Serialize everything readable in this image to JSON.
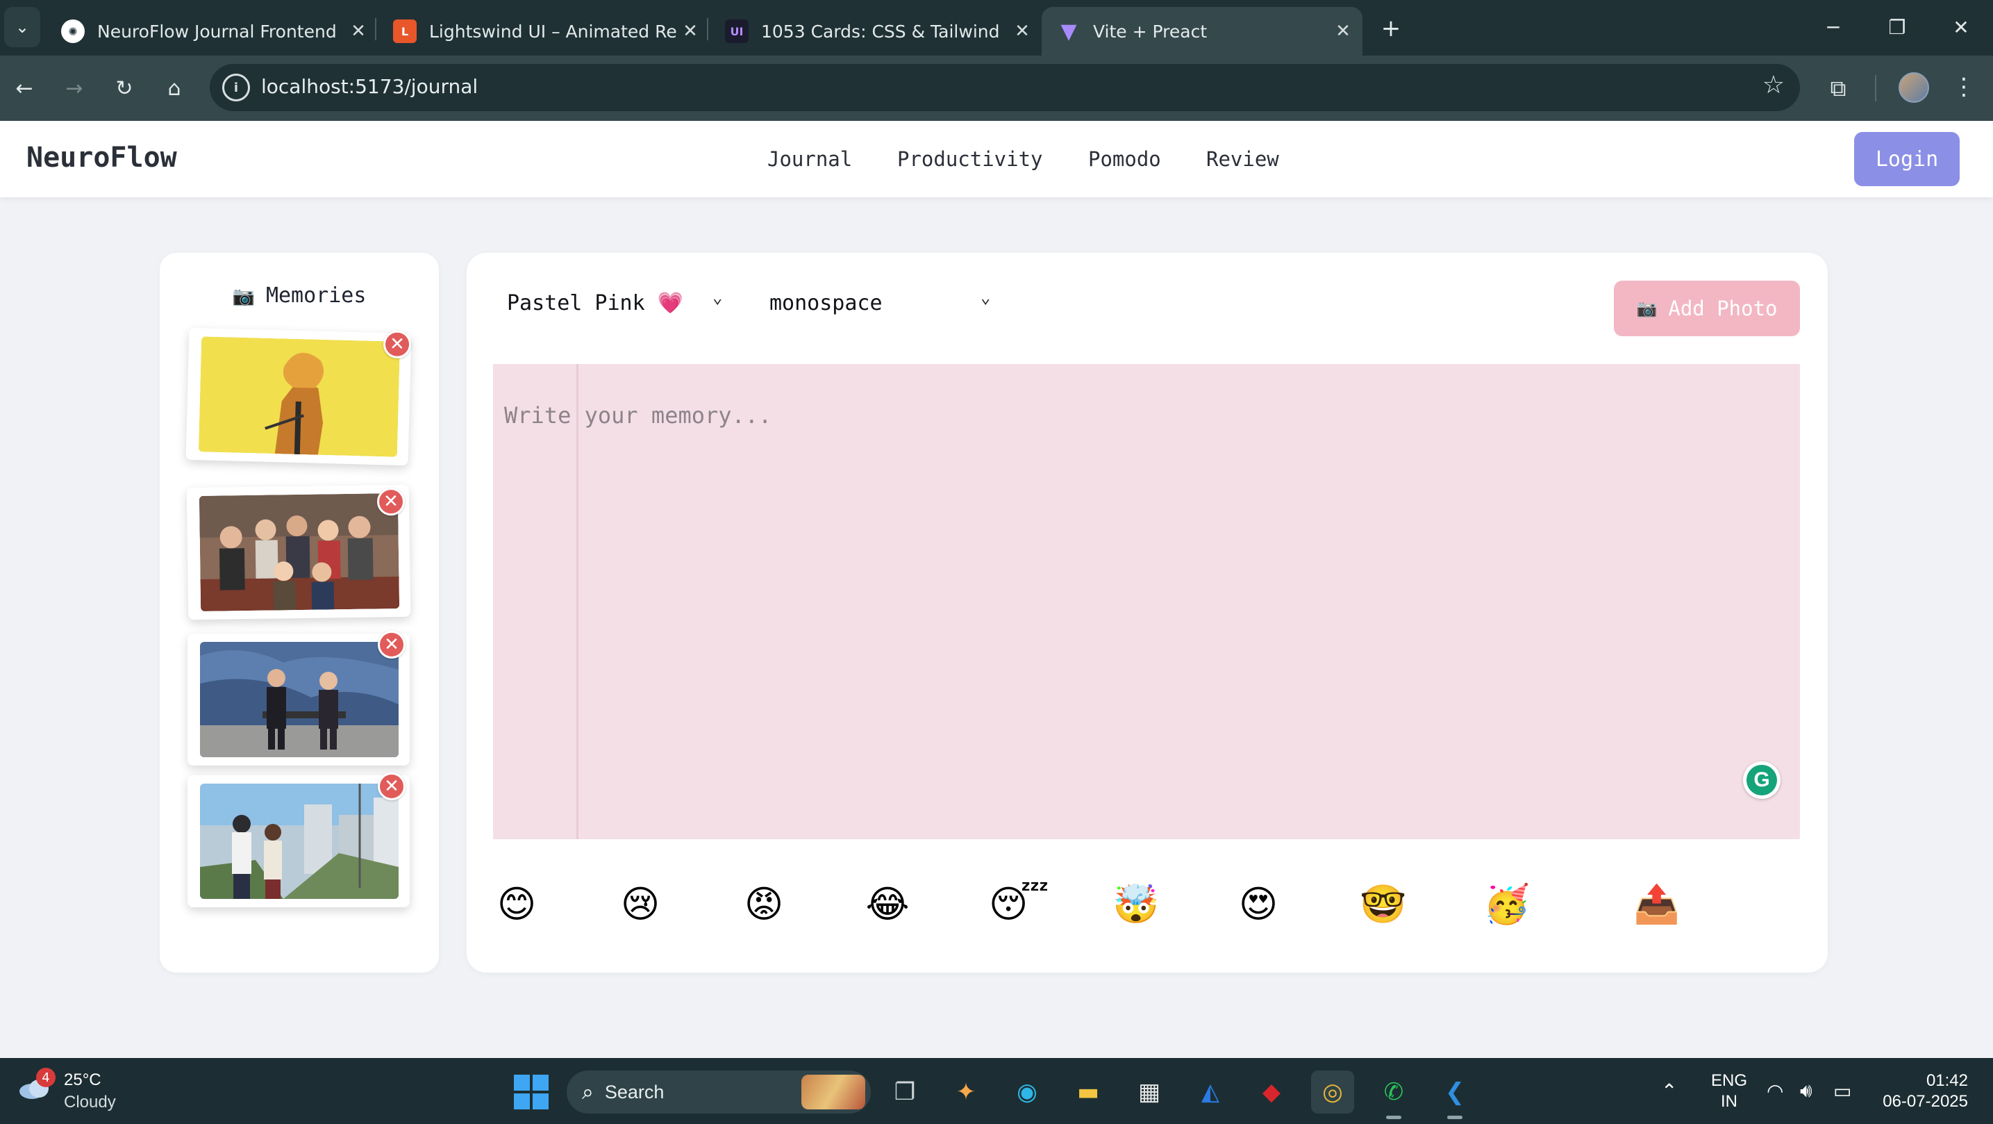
{
  "browser": {
    "tabs": [
      {
        "title": "NeuroFlow Journal Frontend",
        "active": false
      },
      {
        "title": "Lightswind UI – Animated React",
        "active": false
      },
      {
        "title": "1053 Cards: CSS & Tailwind",
        "active": false
      },
      {
        "title": "Vite + Preact",
        "active": true
      }
    ],
    "url": "localhost:5173/journal",
    "window_controls": {
      "minimize": "─",
      "restore": "❐",
      "close": "✕"
    }
  },
  "app": {
    "brand": "NeuroFlow",
    "nav": [
      {
        "label": "Journal"
      },
      {
        "label": "Productivity"
      },
      {
        "label": "Pomodo"
      },
      {
        "label": "Review"
      }
    ],
    "login_label": "Login",
    "accent_color": "#8b8fe6"
  },
  "memories": {
    "icon": "camera-icon",
    "icon_glyph": "📷",
    "title": "Memories",
    "photos": [
      {
        "name": "memory-photo-1",
        "scene": "anime character on yellow background"
      },
      {
        "name": "memory-photo-2",
        "scene": "group of friends on couch"
      },
      {
        "name": "memory-photo-3",
        "scene": "two people on bench with mural"
      },
      {
        "name": "memory-photo-4",
        "scene": "anime street scene"
      }
    ],
    "remove_glyph": "✕"
  },
  "editor": {
    "theme_select": {
      "value": "Pastel Pink 💗",
      "options": [
        "Pastel Pink 💗"
      ]
    },
    "font_select": {
      "value": "monospace",
      "options": [
        "monospace"
      ]
    },
    "add_photo": {
      "icon_glyph": "📷",
      "label": "Add Photo"
    },
    "textarea_placeholder": "Write your memory...",
    "paper_color": "#f4dfe7",
    "button_color": "#f3b7c4",
    "emojis": [
      "😊",
      "😢",
      "😡",
      "😂",
      "😴",
      "🤯",
      "😍",
      "🤓",
      "🥳",
      "📤"
    ]
  },
  "taskbar": {
    "weather": {
      "badge": "4",
      "temp": "25°C",
      "condition": "Cloudy"
    },
    "search_label": "Search",
    "language": {
      "line1": "ENG",
      "line2": "IN"
    },
    "time": "01:42",
    "date": "06-07-2025"
  }
}
